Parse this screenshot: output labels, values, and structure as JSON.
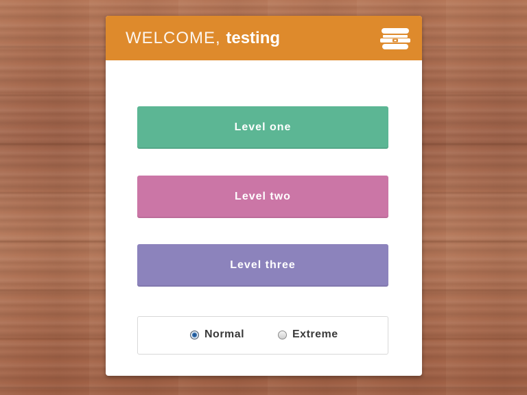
{
  "header": {
    "welcome_label": "WELCOME,",
    "username": "testing",
    "logo_icon": "hamburger-logo-icon",
    "color": "#de8a2c"
  },
  "levels": [
    {
      "label": "Level one",
      "color": "#5cb694"
    },
    {
      "label": "Level two",
      "color": "#cb76a6"
    },
    {
      "label": "Level three",
      "color": "#8c83bc"
    }
  ],
  "mode": {
    "options": [
      {
        "label": "Normal",
        "checked": true
      },
      {
        "label": "Extreme",
        "checked": false
      }
    ],
    "selected": "Normal"
  }
}
